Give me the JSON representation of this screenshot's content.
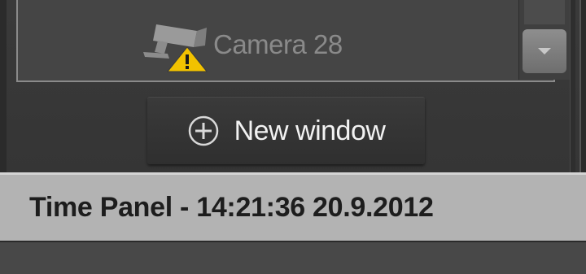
{
  "camera_list": {
    "items": [
      {
        "label": "Camera 28",
        "icon": "camera-warning-icon"
      }
    ],
    "scroll_down_icon": "chevron-down-icon"
  },
  "toolbar": {
    "new_window_label": "New window",
    "new_window_icon": "plus-circle-icon"
  },
  "time_panel": {
    "title": "Time Panel - 14:21:36 20.9.2012"
  },
  "colors": {
    "warning": "#f2c200",
    "panel_header": "#b3b3b3",
    "dark_bg": "#3b3b3b"
  }
}
